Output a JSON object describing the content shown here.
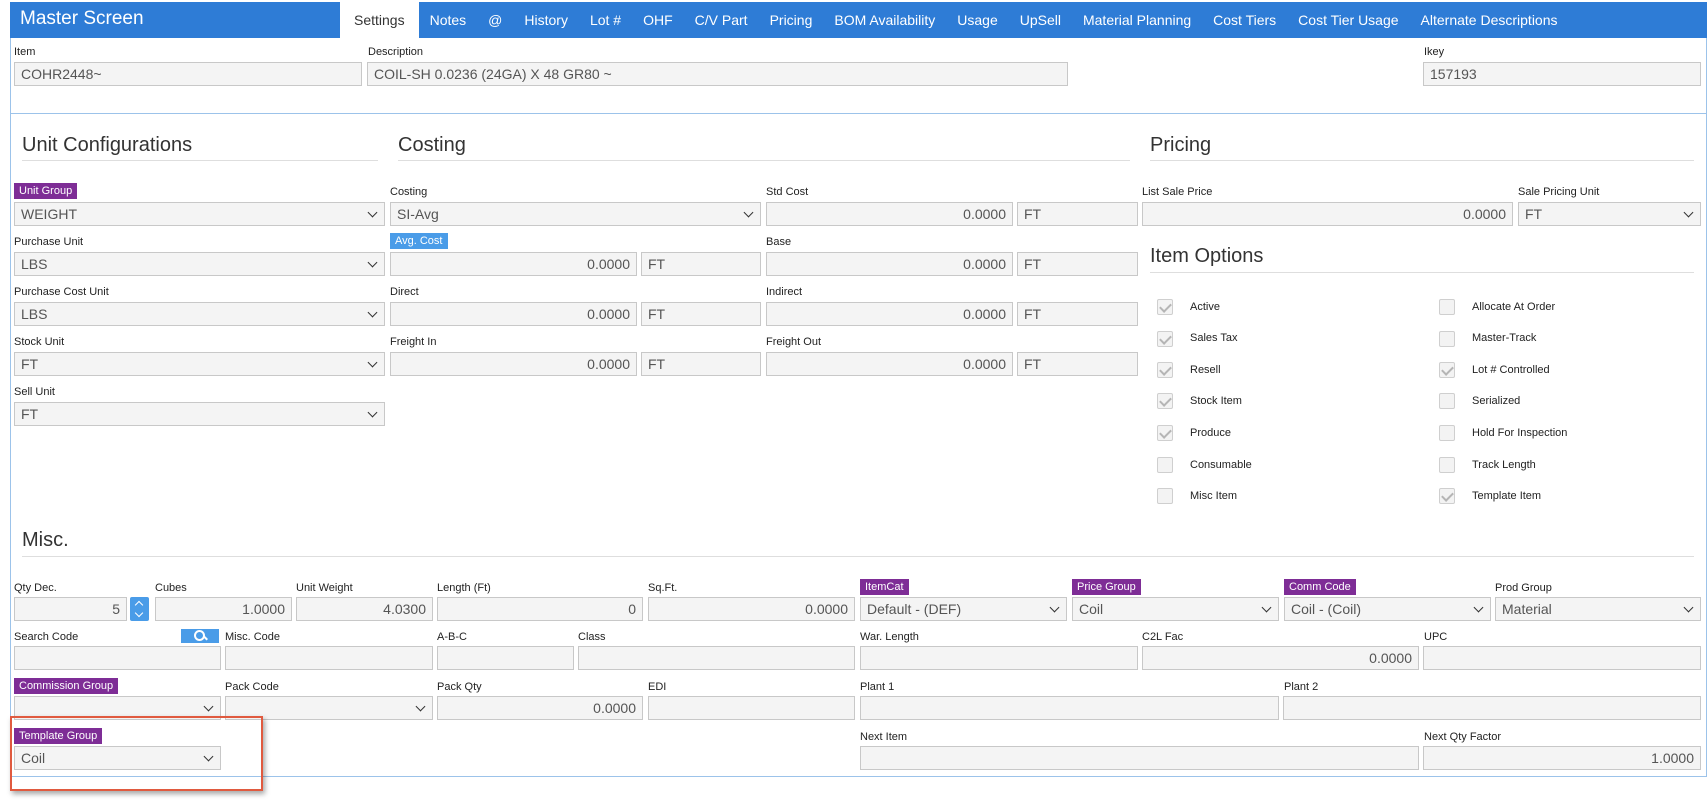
{
  "app": {
    "title": "Master Screen"
  },
  "tabs": [
    {
      "label": "Settings"
    },
    {
      "label": "Notes"
    },
    {
      "label": "@"
    },
    {
      "label": "History"
    },
    {
      "label": "Lot #"
    },
    {
      "label": "OHF"
    },
    {
      "label": "C/V Part"
    },
    {
      "label": "Pricing"
    },
    {
      "label": "BOM Availability"
    },
    {
      "label": "Usage"
    },
    {
      "label": "UpSell"
    },
    {
      "label": "Material Planning"
    },
    {
      "label": "Cost Tiers"
    },
    {
      "label": "Cost Tier Usage"
    },
    {
      "label": "Alternate Descriptions"
    }
  ],
  "header": {
    "item_label": "Item",
    "item_value": "COHR2448~",
    "desc_label": "Description",
    "desc_value": "COIL-SH 0.0236 (24GA) X 48 GR80 ~",
    "ikey_label": "Ikey",
    "ikey_value": "157193"
  },
  "unit_config": {
    "title": "Unit Configurations",
    "unit_group_label": "Unit Group",
    "unit_group_value": "WEIGHT",
    "purchase_unit_label": "Purchase Unit",
    "purchase_unit_value": "LBS",
    "purchase_cost_unit_label": "Purchase Cost Unit",
    "purchase_cost_unit_value": "LBS",
    "stock_unit_label": "Stock Unit",
    "stock_unit_value": "FT",
    "sell_unit_label": "Sell Unit",
    "sell_unit_value": "FT"
  },
  "costing": {
    "title": "Costing",
    "costing_label": "Costing",
    "costing_value": "SI-Avg",
    "avg_cost_label": "Avg. Cost",
    "avg_cost_value": "0.0000",
    "avg_cost_unit": "FT",
    "direct_label": "Direct",
    "direct_value": "0.0000",
    "direct_unit": "FT",
    "freight_in_label": "Freight In",
    "freight_in_value": "0.0000",
    "freight_in_unit": "FT",
    "std_cost_label": "Std Cost",
    "std_cost_value": "0.0000",
    "std_cost_unit": "FT",
    "base_label": "Base",
    "base_value": "0.0000",
    "base_unit": "FT",
    "indirect_label": "Indirect",
    "indirect_value": "0.0000",
    "indirect_unit": "FT",
    "freight_out_label": "Freight Out",
    "freight_out_value": "0.0000",
    "freight_out_unit": "FT"
  },
  "pricing": {
    "title": "Pricing",
    "list_sale_price_label": "List Sale Price",
    "list_sale_price_value": "0.0000",
    "sale_pricing_unit_label": "Sale Pricing Unit",
    "sale_pricing_unit_value": "FT"
  },
  "item_options": {
    "title": "Item Options",
    "left": [
      {
        "label": "Active",
        "checked": true
      },
      {
        "label": "Sales Tax",
        "checked": true
      },
      {
        "label": "Resell",
        "checked": true
      },
      {
        "label": "Stock Item",
        "checked": true
      },
      {
        "label": "Produce",
        "checked": true
      },
      {
        "label": "Consumable",
        "checked": false
      },
      {
        "label": "Misc Item",
        "checked": false
      }
    ],
    "right": [
      {
        "label": "Allocate At Order",
        "checked": false
      },
      {
        "label": "Master-Track",
        "checked": false
      },
      {
        "label": "Lot # Controlled",
        "checked": true
      },
      {
        "label": "Serialized",
        "checked": false
      },
      {
        "label": "Hold For Inspection",
        "checked": false
      },
      {
        "label": "Track Length",
        "checked": false
      },
      {
        "label": "Template Item",
        "checked": true
      }
    ]
  },
  "misc": {
    "title": "Misc.",
    "qty_dec_label": "Qty Dec.",
    "qty_dec_value": "5",
    "cubes_label": "Cubes",
    "cubes_value": "1.0000",
    "unit_weight_label": "Unit Weight",
    "unit_weight_value": "4.0300",
    "length_label": "Length (Ft)",
    "length_value": "0",
    "sqft_label": "Sq.Ft.",
    "sqft_value": "0.0000",
    "itemcat_label": "ItemCat",
    "itemcat_value": "Default - (DEF)",
    "price_group_label": "Price Group",
    "price_group_value": "Coil",
    "comm_code_label": "Comm Code",
    "comm_code_value": "Coil - (Coil)",
    "prod_group_label": "Prod Group",
    "prod_group_value": "Material",
    "search_code_label": "Search Code",
    "search_code_value": "",
    "misc_code_label": "Misc. Code",
    "misc_code_value": "",
    "abc_label": "A-B-C",
    "abc_value": "",
    "class_label": "Class",
    "class_value": "",
    "war_length_label": "War. Length",
    "war_length_value": "",
    "c2l_fac_label": "C2L Fac",
    "c2l_fac_value": "0.0000",
    "upc_label": "UPC",
    "upc_value": "",
    "commission_group_label": "Commission Group",
    "commission_group_value": "",
    "pack_code_label": "Pack Code",
    "pack_code_value": "",
    "pack_qty_label": "Pack Qty",
    "pack_qty_value": "0.0000",
    "edi_label": "EDI",
    "edi_value": "",
    "plant1_label": "Plant 1",
    "plant1_value": "",
    "plant2_label": "Plant 2",
    "plant2_value": "",
    "template_group_label": "Template Group",
    "template_group_value": "Coil",
    "next_item_label": "Next Item",
    "next_item_value": "",
    "next_qty_factor_label": "Next Qty Factor",
    "next_qty_factor_value": "1.0000"
  },
  "icons": {
    "search": "search-icon",
    "spinner": "spinner-arrows-icon",
    "dropdown": "chevron-down-icon",
    "checkbox": "checkbox-icon"
  },
  "colors": {
    "header_blue": "#2e7cd6",
    "badge_purple": "#7e2d96",
    "badge_blue": "#4a9ce8",
    "highlight_red": "#e05a3f"
  }
}
